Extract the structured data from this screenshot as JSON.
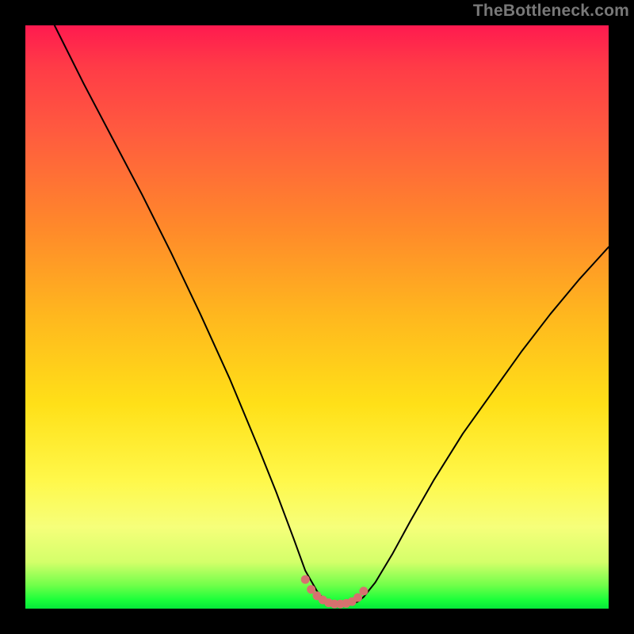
{
  "watermark": "TheBottleneck.com",
  "chart_data": {
    "type": "line",
    "title": "",
    "xlabel": "",
    "ylabel": "",
    "xlim": [
      0,
      100
    ],
    "ylim": [
      0,
      100
    ],
    "series": [
      {
        "name": "curve",
        "x": [
          5,
          10,
          15,
          20,
          25,
          30,
          35,
          40,
          43,
          46,
          48,
          50,
          51,
          52,
          53,
          54,
          55,
          56,
          57,
          58,
          60,
          63,
          66,
          70,
          75,
          80,
          85,
          90,
          95,
          100
        ],
        "values": [
          100,
          90,
          80.5,
          71,
          61,
          50.5,
          39.5,
          27.5,
          20,
          12,
          6.5,
          3,
          1.8,
          1.1,
          0.8,
          0.7,
          0.7,
          0.8,
          1.2,
          2,
          4.5,
          9.5,
          15,
          22,
          30,
          37,
          44,
          50.5,
          56.5,
          62
        ]
      },
      {
        "name": "marker-cluster",
        "x": [
          48,
          49,
          50,
          51,
          52,
          53,
          54,
          55,
          56,
          57,
          58
        ],
        "values": [
          5.0,
          3.3,
          2.2,
          1.5,
          1.0,
          0.8,
          0.8,
          0.9,
          1.2,
          1.9,
          3.0
        ]
      }
    ],
    "colors": {
      "curve": "#000000",
      "marker": "#d6716f"
    }
  }
}
